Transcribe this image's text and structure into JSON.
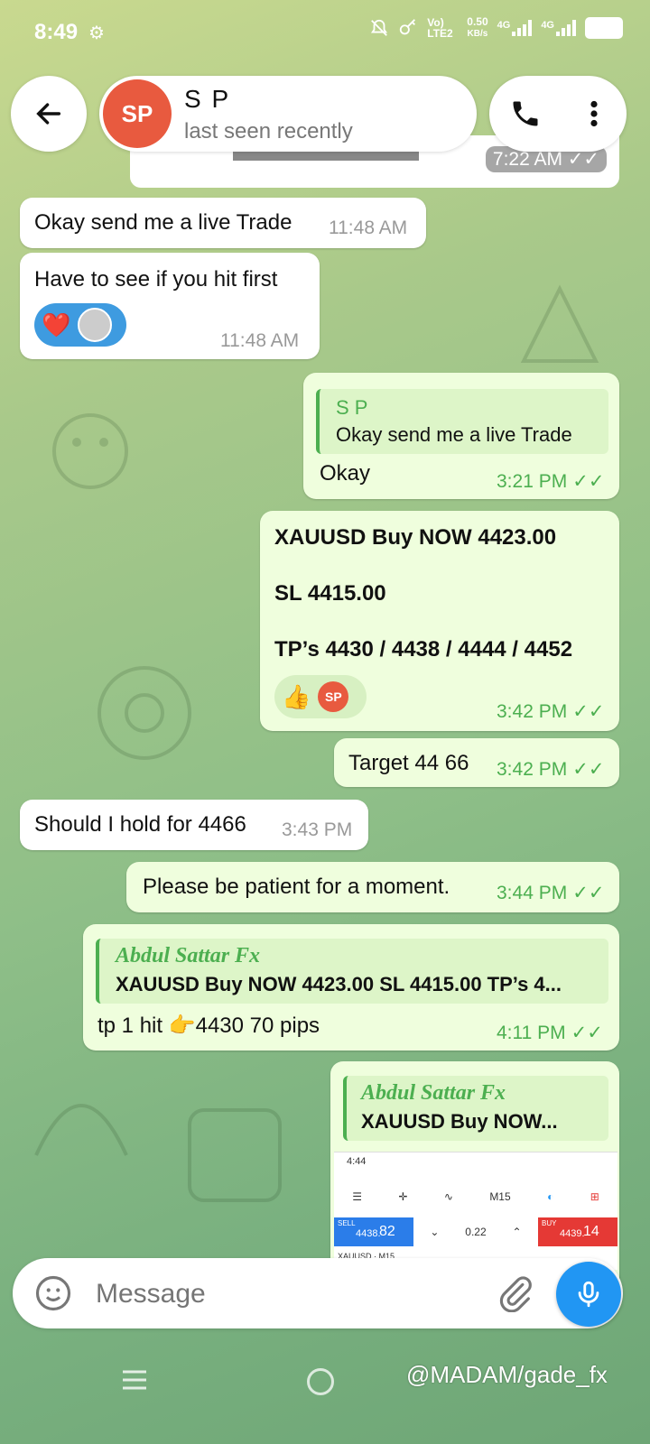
{
  "status_bar": {
    "time": "8:49",
    "net_label": "Vo) LTE2",
    "speed": "0.50",
    "speed_unit": "KB/s",
    "gen1": "4G",
    "gen2": "4G"
  },
  "header": {
    "avatar_initials": "SP",
    "contact_name": "S P",
    "last_seen": "last seen recently"
  },
  "top_image": {
    "time": "7:22 AM"
  },
  "messages": [
    {
      "text": "Okay send me a live Trade",
      "time": "11:48 AM"
    },
    {
      "text": "Have to see if you hit first",
      "time": "11:48 AM",
      "reactions": [
        "❤️"
      ]
    },
    {
      "reply_name": "S P",
      "reply_text": "Okay send me a live Trade",
      "text": "Okay",
      "time": "3:21 PM"
    },
    {
      "line1": "XAUUSD Buy NOW 4423.00",
      "line2": "SL 4415.00",
      "line3": "TP’s 4430 / 4438 / 4444 / 4452",
      "reaction": "👍",
      "reaction_avatar": "SP",
      "time": "3:42 PM"
    },
    {
      "text": "Target 44 66",
      "time": "3:42 PM"
    },
    {
      "text": "Should I hold for 4466",
      "time": "3:43 PM"
    },
    {
      "text": "Please be patient for a moment.",
      "time": "3:44 PM"
    },
    {
      "reply_name": "Abdul Sattar Fx",
      "reply_text": "XAUUSD Buy NOW 4423.00  SL 4415.00  TP’s 4...",
      "text": "tp 1 hit 👉4430  70 pips",
      "time": "4:11 PM"
    },
    {
      "reply_name": "Abdul Sattar Fx",
      "reply_text": "XAUUSD Buy NOW..."
    }
  ],
  "screenshot": {
    "time": "4:44",
    "timeframe": "M15",
    "sell_label": "SELL",
    "sell_price_main": "4438.",
    "sell_price_big": "82",
    "spread": "0.22",
    "buy_label": "BUY",
    "buy_price_main": "4439.",
    "buy_price_big": "14",
    "symbol": "XAUUSD · M15"
  },
  "input": {
    "placeholder": "Message"
  },
  "watermark": "@MADAM/gade_fx",
  "colors": {
    "accent": "#4caf50",
    "mic": "#2196f3",
    "avatar": "#e85a3f"
  }
}
